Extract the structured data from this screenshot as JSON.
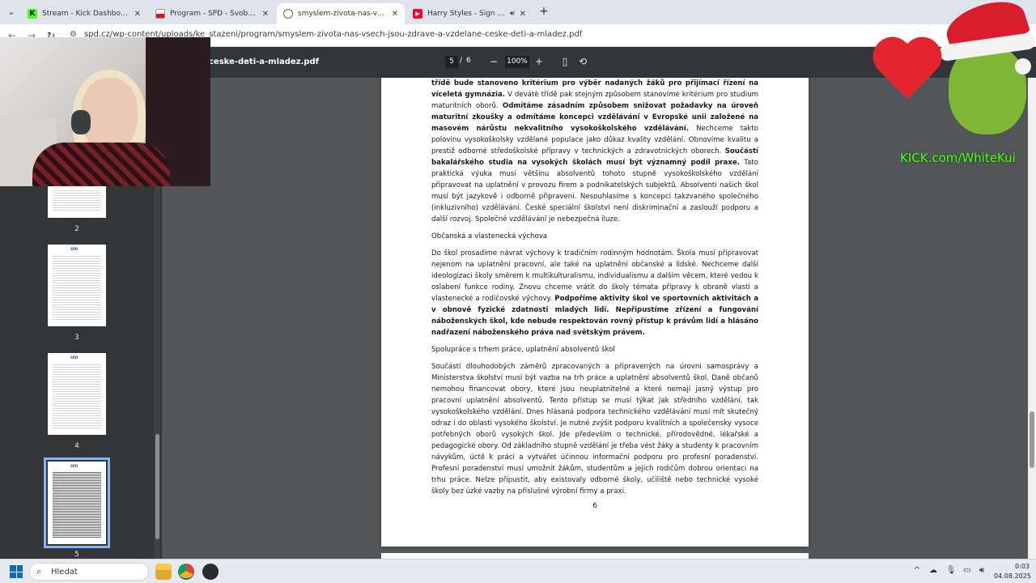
{
  "browser": {
    "tabs": [
      {
        "label": "Stream - Kick Dashboard",
        "favicon": "kick-icon",
        "color": "#53fc18"
      },
      {
        "label": "Program - SPD - Svoboda a přímá",
        "favicon": "spd-flag-icon",
        "color": "#d7141a"
      },
      {
        "label": "smyslem-zivota-nas-vsech-jsou",
        "favicon": "globe-icon",
        "color": "#5f6368"
      },
      {
        "label": "Harry Styles - Sign of the Ti",
        "favicon": "youtube-icon",
        "color": "#ff0033"
      }
    ],
    "url": "spd.cz/wp-content/uploads/ke_stazeni/program/smyslem-zivota-nas-vsech-jsou-zdrave-a-vzdelane-ceske-deti-a-mladez.pdf"
  },
  "pdf": {
    "filename": "ceske-deti-a-mladez.pdf",
    "current_page": "5",
    "page_sep": "/",
    "total_pages": "6",
    "zoom": "100%",
    "thumbnails": [
      {
        "label": "2",
        "logo": ""
      },
      {
        "label": "3",
        "logo": "SPD"
      },
      {
        "label": "4",
        "logo": "SPD"
      },
      {
        "label": "5",
        "logo": "SPD"
      }
    ],
    "page_number": "6"
  },
  "content": {
    "p1_b1": "třídě bude stanoveno kritérium pro výběr nadaných žáků pro přijímací řízení na víceletá gymnázia.",
    "p1_t1": " V deváté třídě pak stejným způsobem stanovíme kritérium pro studium maturitních oborů. ",
    "p1_b2": "Odmítáme zásadním způsobem snižovat požadavky na úroveň maturitní zkoušky a odmítáme koncepci vzdělávání v Evropské unii založené na masovém nárůstu nekvalitního vysokoškolského vzdělávání.",
    "p1_t2": " Nechceme takto polovinu vysokoškolsky vzdělané populace jako důkaz kvality vzdělání. Obnovíme kvalitu a prestiž odborné středoškolské přípravy v technických a zdravotnických oborech. ",
    "p1_b3": "Součástí bakalářského studia na vysokých školách musí být významný podíl praxe.",
    "p1_t3": " Tato praktická výuka musí většinu absolventů tohoto stupně vysokoškolského vzdělání připravovat na uplatnění v provozu firem a podnikatelských subjektů. Absolventi našich škol musí být jazykově i odborně připraveni. Nesouhlasíme s koncepcí takzvaného společného (inkluzivního) vzdělávání. České speciální školství není diskriminační a zaslouží podporu a další rozvoj. Společné vzdělávání je nebezpečná iluze.",
    "h2": "Občanská a vlastenecká výchova",
    "p2_t1": "Do škol prosadíme návrat výchovy k tradičním rodinným hodnotám. Škola musí připravovat nejenom na uplatnění pracovní, ale také na uplatnění občanské a lidské. Nechceme další ideologizaci školy směrem k multikulturalismu, individualismu a dalším věcem, které vedou k oslabení funkce rodiny. Znovu chceme vrátit do školy témata přípravy k obraně vlasti a vlastenecké a rodičovské výchovy. ",
    "p2_b1": "Podpoříme aktivity škol ve sportovních aktivitách a v obnově fyzické zdatnosti mladých lidí. Nepřipustíme zřízení a fungování náboženských škol, kde nebude  respektován rovný přístup k právům lidí a hlásáno nadřazení náboženského práva nad světským právem.",
    "h3": "Spolupráce s trhem práce, uplatnění absolventů škol",
    "p3": "Součástí dlouhodobých záměrů zpracovaných a připravených na úrovni samosprávy a Ministerstva školství musí být vazba na trh práce a uplatnění absolventů škol. Daně občanů nemohou financovat obory, které jsou neuplatnitelné a které nemají jasný výstup pro pracovní uplatnění absolventů. Tento přístup se musí týkat jak středního vzdělání, tak vysokoškolského vzdělání. Dnes hlásaná podpora technického vzdělávání musí mít skutečný odraz i do oblasti vysokého školství. Je nutné zvýšit podporu kvalitních a společensky vysoce potřebných oborů vysokých škol. Jde především o technické, přírodovědné, lékařské a pedagogické obory. Od základního stupně vzdělání je třeba vést žáky a studenty k pracovním návykům, úctě k práci a vytvářet účinnou informační podporu pro profesní poradenství. Profesní poradenství musí umožnit žákům, studentům a jejich rodičům dobrou orientaci na trhu práce. Nelze připustit, aby existovaly odborné školy, učiliště nebo technické vysoké školy bez úzké vazby na příslušné výrobní firmy a praxi."
  },
  "overlay": {
    "kick_url": "KICK.com/WhiteKui"
  },
  "taskbar": {
    "search_placeholder": "Hledat",
    "time": "0:03",
    "date": "04.08.2025"
  }
}
